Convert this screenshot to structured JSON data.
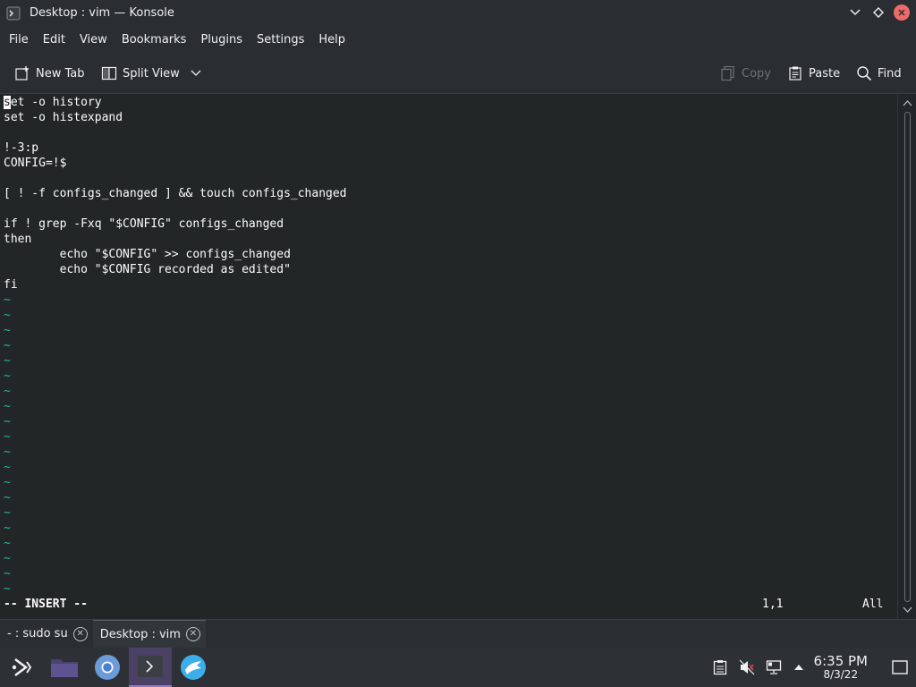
{
  "window": {
    "title": "Desktop : vim — Konsole"
  },
  "menubar": [
    "File",
    "Edit",
    "View",
    "Bookmarks",
    "Plugins",
    "Settings",
    "Help"
  ],
  "toolbar": {
    "new_tab": "New Tab",
    "split_view": "Split View",
    "copy": "Copy",
    "paste": "Paste",
    "find": "Find"
  },
  "editor": {
    "cursor_char": "s",
    "first_line_rest": "et -o history",
    "lines": [
      "set -o histexpand",
      "",
      "!-3:p",
      "CONFIG=!$",
      "",
      "[ ! -f configs_changed ] && touch configs_changed",
      "",
      "if ! grep -Fxq \"$CONFIG\" configs_changed",
      "then",
      "        echo \"$CONFIG\" >> configs_changed",
      "        echo \"$CONFIG recorded as edited\"",
      "fi"
    ],
    "tilde": "~",
    "tilde_count": 20,
    "mode": "-- INSERT --",
    "position": "1,1",
    "scroll": "All"
  },
  "tabs": [
    {
      "label": "- : sudo su",
      "active": false
    },
    {
      "label": "Desktop : vim",
      "active": true
    }
  ],
  "panel": {
    "apps": [
      "application-launcher-icon",
      "file-manager-icon",
      "chromium-icon",
      "konsole-icon",
      "discover-icon"
    ],
    "time": "6:35 PM",
    "date": "8/3/22"
  },
  "colors": {
    "terminal_bg": "#232627",
    "tilde": "#1abc9c",
    "close_button": "#ed6a6a",
    "active_task": "#4b4165"
  }
}
